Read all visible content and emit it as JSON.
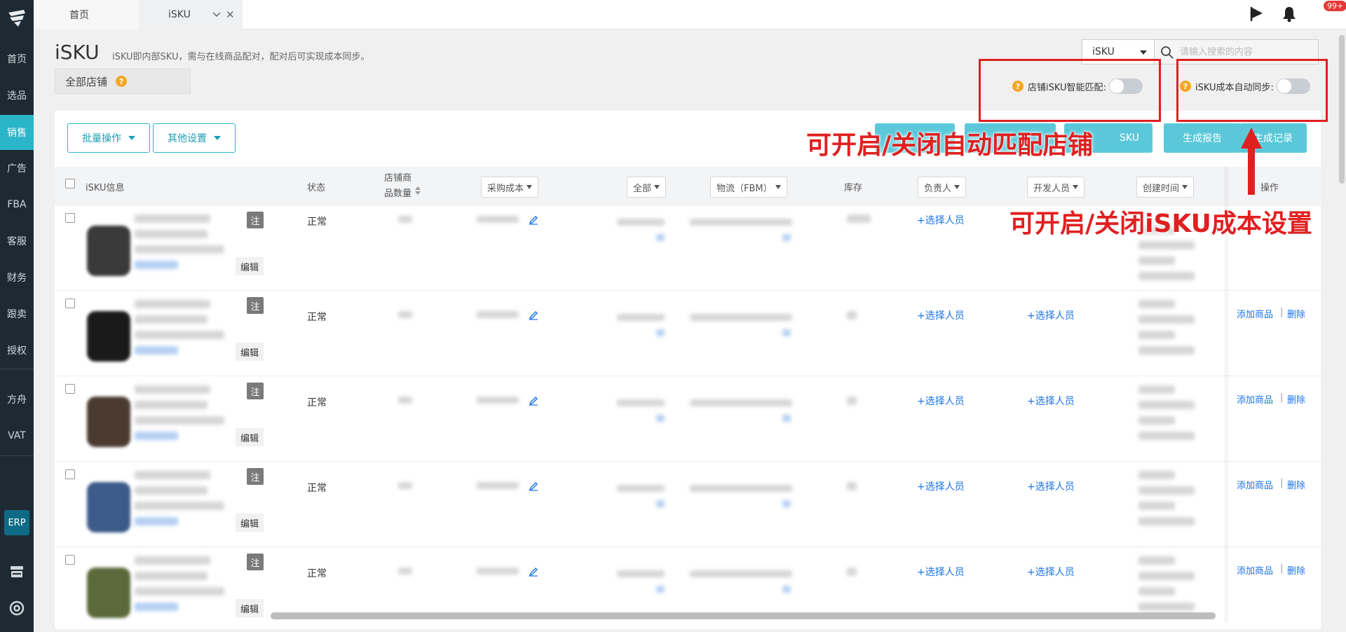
{
  "sidebar": {
    "items": [
      {
        "label": "首页",
        "active": false
      },
      {
        "label": "选品",
        "active": false
      },
      {
        "label": "销售",
        "active": true
      },
      {
        "label": "广告",
        "active": false
      },
      {
        "label": "FBA",
        "active": false
      },
      {
        "label": "客服",
        "active": false
      },
      {
        "label": "财务",
        "active": false
      },
      {
        "label": "跟卖",
        "active": false
      },
      {
        "label": "授权",
        "active": false
      },
      {
        "label": "方舟",
        "active": false
      },
      {
        "label": "VAT",
        "active": false
      }
    ],
    "erp_label": "ERP",
    "bottom_icons": [
      "store-icon",
      "support-icon"
    ]
  },
  "tabs": {
    "home": "首页",
    "isku": "iSKU"
  },
  "header": {
    "notification_count": "99+",
    "accent_color": "#2bb5c9"
  },
  "page": {
    "title": "iSKU",
    "description": "iSKU即内部SKU，需与在线商品配对，配对后可实现成本同步。",
    "shop_select": "全部店铺"
  },
  "search": {
    "type": "iSKU",
    "placeholder": "请输入搜索的内容"
  },
  "toggles": {
    "smart_match": "店铺iSKU智能匹配:",
    "cost_sync": "iSKU成本自动同步:"
  },
  "toolbar": {
    "batch": "批量操作",
    "other_settings": "其他设置",
    "isku_btn": "SKU",
    "report": "生成报告",
    "records": "生成记录"
  },
  "annotations": {
    "match": "可开启/关闭自动匹配店铺",
    "cost": "可开启/关闭iSKU成本设置"
  },
  "table": {
    "headers": {
      "info": "iSKU信息",
      "status": "状态",
      "shop_count_1": "店铺商",
      "shop_count_2": "品数量",
      "purchase_cost": "采购成本",
      "all": "全部",
      "logistics": "物流（FBM）",
      "stock": "库存",
      "owner": "负责人",
      "developer": "开发人员",
      "created": "创建时间",
      "ops": "操作"
    },
    "tag_label": "注",
    "edit_label": "编辑",
    "select_person": "+选择人员",
    "add_product": "添加商品",
    "delete": "删除",
    "rows": [
      {
        "status": "正常",
        "thumb": "#3a3a3a"
      },
      {
        "status": "正常",
        "thumb": "#1a1a1a"
      },
      {
        "status": "正常",
        "thumb": "#4a3a30"
      },
      {
        "status": "正常",
        "thumb": "#3c5a8a"
      },
      {
        "status": "正常",
        "thumb": "#5a6a3a"
      }
    ]
  }
}
